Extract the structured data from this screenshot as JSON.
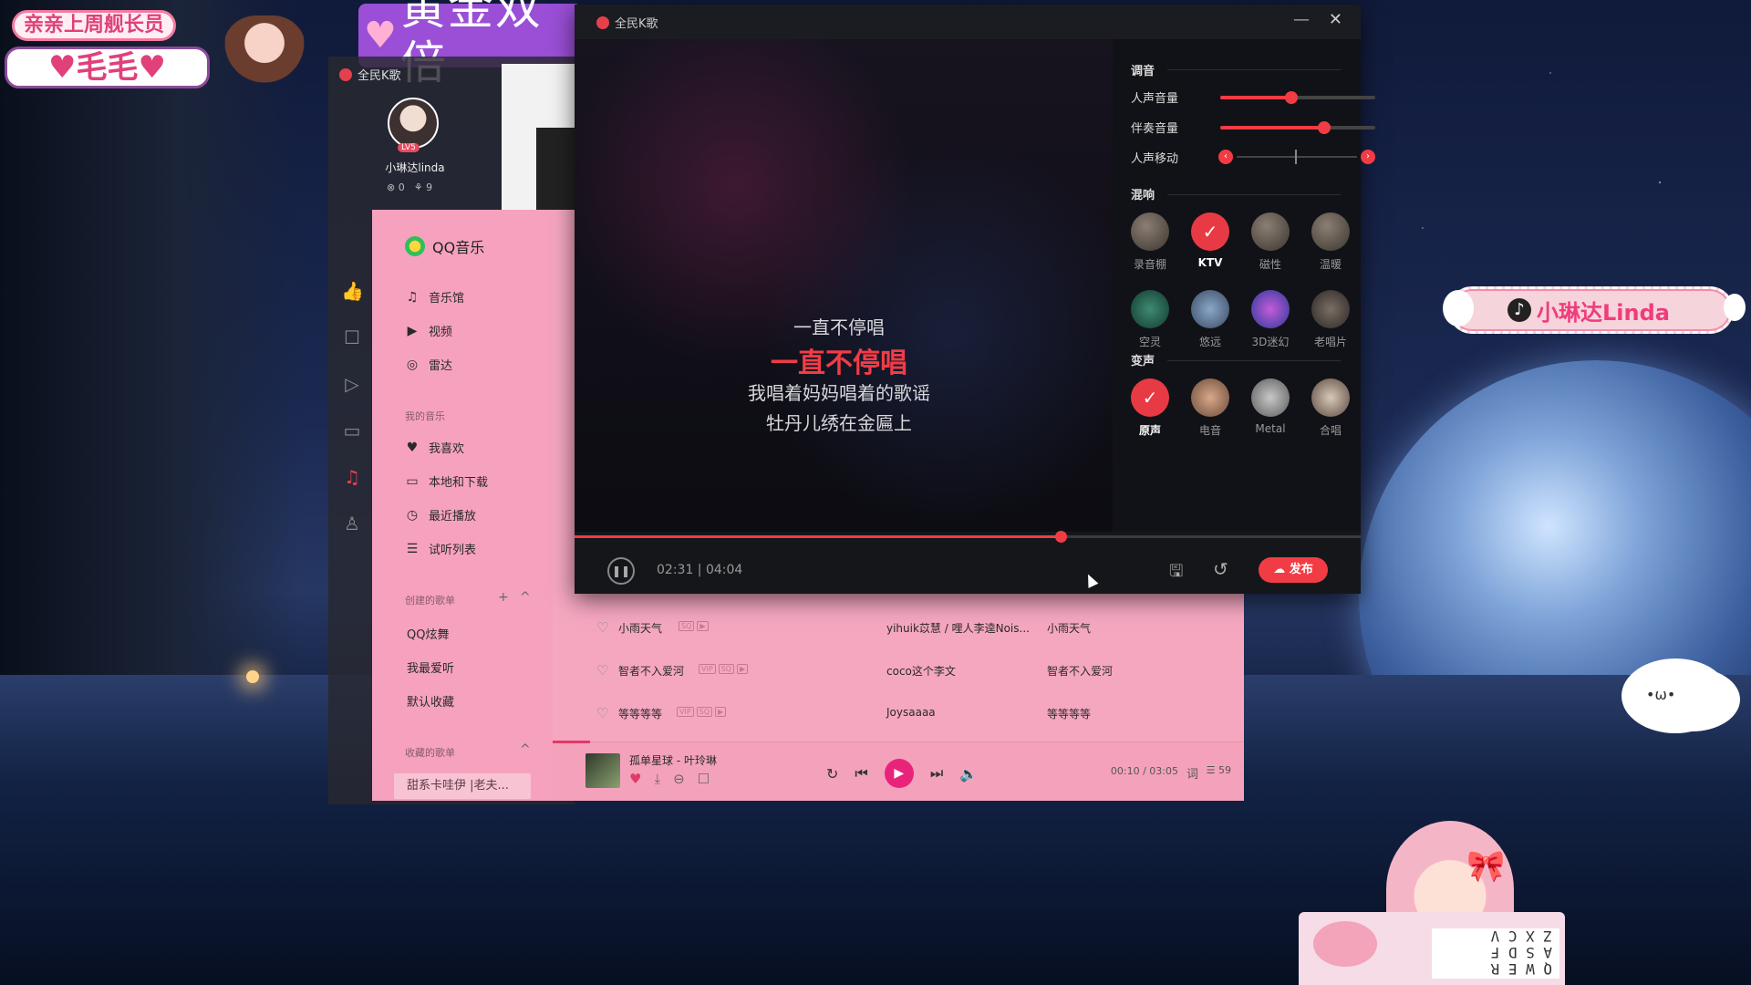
{
  "overlay": {
    "top_left_line1": "亲亲上周舰长员",
    "top_left_name": "♥毛毛♥",
    "gold_banner": "黄金双倍",
    "tiktok_name": "小琳达Linda",
    "cloud_face": "•ω•"
  },
  "ksong_side": {
    "title": "全民K歌",
    "username": "小琳达linda",
    "level_badge": "LV5",
    "stat_a": "0",
    "stat_b": "9",
    "icons": [
      "thumbs-up-icon",
      "chat-icon",
      "video-icon",
      "monitor-icon",
      "music-list-icon",
      "ktv-mic-icon"
    ]
  },
  "qqmusic": {
    "logo": "QQ音乐",
    "nav": [
      {
        "label": "音乐馆",
        "icon": "♫"
      },
      {
        "label": "视频",
        "icon": "▶"
      },
      {
        "label": "雷达",
        "icon": "◎"
      }
    ],
    "my_music_section": "我的音乐",
    "my_music": [
      {
        "label": "我喜欢",
        "icon": "♥"
      },
      {
        "label": "本地和下载",
        "icon": "▭"
      },
      {
        "label": "最近播放",
        "icon": "◷"
      },
      {
        "label": "试听列表",
        "icon": "☰"
      }
    ],
    "created_section": "创建的歌单",
    "created": [
      "QQ炫舞",
      "我最爱听",
      "默认收藏"
    ],
    "collected_section": "收藏的歌单",
    "collected_selected": "甜系卡哇伊 |老夫...",
    "songs": [
      {
        "name": "小雨天气",
        "tags": [
          "SQ",
          "▶"
        ],
        "singer": "yihuik苡慧 / 哩人李逵Nois...",
        "album": "小雨天气"
      },
      {
        "name": "智者不入爱河",
        "tags": [
          "VIP",
          "SQ",
          "▶"
        ],
        "singer": "coco这个李文",
        "album": "智者不入爱河"
      },
      {
        "name": "等等等等",
        "tags": [
          "VIP",
          "SQ",
          "▶"
        ],
        "singer": "Joysaaaa",
        "album": "等等等等"
      }
    ],
    "player": {
      "title": "孤单星球 - 叶玲琳",
      "time": "00:10 / 03:05",
      "lyric_btn": "词",
      "list_count": "59",
      "progress": 0.054
    }
  },
  "karaoke": {
    "title": "全民K歌",
    "lyrics": [
      "一直不停唱",
      "一直不停唱",
      "我唱着妈妈唱着的歌谣",
      "牡丹儿绣在金匾上"
    ],
    "tuning_section": "调音",
    "vocal_volume_label": "人声音量",
    "vocal_volume": 0.46,
    "accomp_volume_label": "伴奏音量",
    "accomp_volume": 0.67,
    "vocal_shift_label": "人声移动",
    "reverb_section": "混响",
    "reverb": [
      {
        "label": "录音棚",
        "selected": false
      },
      {
        "label": "KTV",
        "selected": true
      },
      {
        "label": "磁性",
        "selected": false
      },
      {
        "label": "温暖",
        "selected": false
      },
      {
        "label": "空灵",
        "selected": false
      },
      {
        "label": "悠远",
        "selected": false
      },
      {
        "label": "3D迷幻",
        "selected": false
      },
      {
        "label": "老唱片",
        "selected": false
      }
    ],
    "voice_section": "变声",
    "voice": [
      {
        "label": "原声",
        "selected": true
      },
      {
        "label": "电音",
        "selected": false
      },
      {
        "label": "Metal",
        "selected": false
      },
      {
        "label": "合唱",
        "selected": false
      }
    ],
    "time": "02:31 | 04:04",
    "progress": 0.62,
    "publish_label": "发布"
  },
  "colors": {
    "accent_red": "#f23c45",
    "qq_pink": "#f5a7c0",
    "qq_play": "#e8247a"
  }
}
